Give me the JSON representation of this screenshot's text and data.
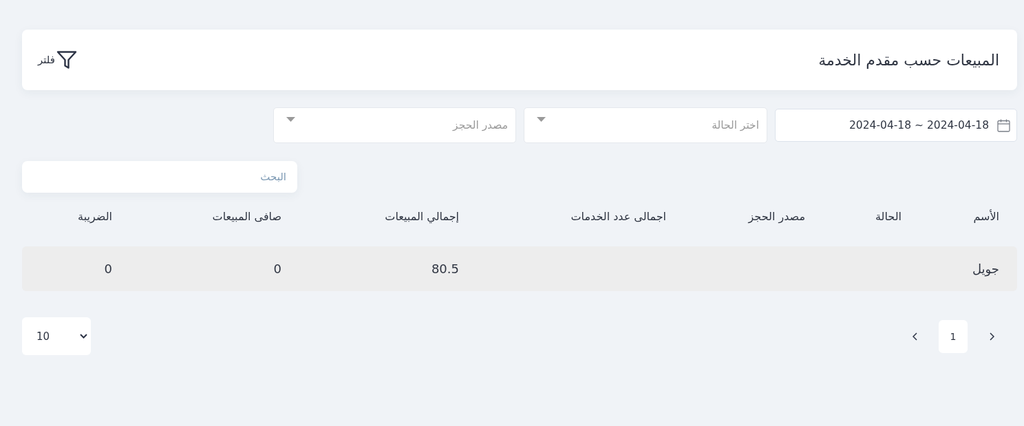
{
  "header": {
    "title": "المبيعات حسب مقدم الخدمة",
    "filter_button": "فلتر"
  },
  "filters": [
    {
      "kind": "date",
      "value": "2024-04-18 ~ 2024-04-18"
    },
    {
      "kind": "select",
      "placeholder": "اختر الحالة"
    },
    {
      "kind": "select",
      "placeholder": "مصدر الحجز"
    }
  ],
  "search": {
    "placeholder": "البحث"
  },
  "table": {
    "columns": [
      "الأسم",
      "الحالة",
      "مصدر الحجز",
      "اجمالى عدد الخدمات",
      "إجمالي المبيعات",
      "صافى المبيعات",
      "الضريبة"
    ],
    "rows": [
      {
        "cells": [
          "جويل",
          null,
          null,
          null,
          "80.5",
          "0",
          "0"
        ]
      }
    ]
  },
  "pagination": {
    "pages": [
      {
        "label": "1",
        "selected": true
      }
    ],
    "page_size": "10"
  }
}
